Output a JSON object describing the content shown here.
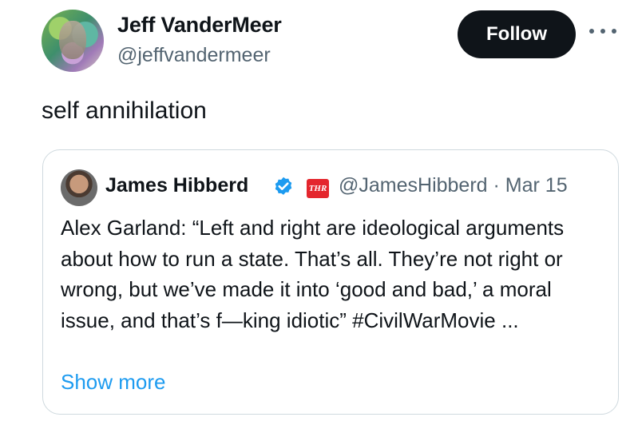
{
  "author": {
    "name": "Jeff VanderMeer",
    "handle": "@jeffvandermeer",
    "follow_label": "Follow"
  },
  "tweet": {
    "text": "self annihilation"
  },
  "quote": {
    "name": "James Hibberd",
    "badge_logo_text": "THR",
    "handle": "@JamesHibberd",
    "separator": "·",
    "date": "Mar 15",
    "body": "Alex Garland: “Left and right are ideological arguments about how to run a state. That’s all. They’re not right or wrong, but we’ve made it into ‘good and bad,’ a moral issue, and that’s f—king idiotic” #CivilWarMovie ...",
    "show_more": "Show more"
  },
  "colors": {
    "follow_bg": "#0f1419",
    "verified": "#1d9bf0",
    "link": "#1d9bf0",
    "secondary_text": "#536471"
  },
  "icons": [
    "more-icon",
    "verified-icon",
    "thr-logo"
  ]
}
